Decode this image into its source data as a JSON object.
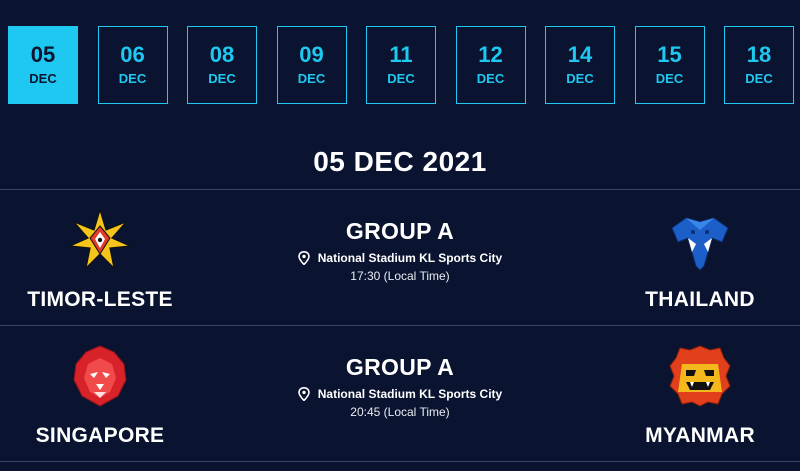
{
  "dates": [
    {
      "day": "05",
      "month": "DEC",
      "active": true
    },
    {
      "day": "06",
      "month": "DEC",
      "active": false
    },
    {
      "day": "08",
      "month": "DEC",
      "active": false
    },
    {
      "day": "09",
      "month": "DEC",
      "active": false
    },
    {
      "day": "11",
      "month": "DEC",
      "active": false
    },
    {
      "day": "12",
      "month": "DEC",
      "active": false
    },
    {
      "day": "14",
      "month": "DEC",
      "active": false
    },
    {
      "day": "15",
      "month": "DEC",
      "active": false
    },
    {
      "day": "18",
      "month": "DEC",
      "active": false
    }
  ],
  "day_title": "05 DEC 2021",
  "matches": [
    {
      "home": {
        "name": "TIMOR-LESTE",
        "crest": "timor-leste-star-crest-icon"
      },
      "away": {
        "name": "THAILAND",
        "crest": "thailand-elephant-crest-icon"
      },
      "group": "GROUP A",
      "venue": "National Stadium KL Sports City",
      "time": "17:30 (Local Time)"
    },
    {
      "home": {
        "name": "SINGAPORE",
        "crest": "singapore-lion-crest-icon"
      },
      "away": {
        "name": "MYANMAR",
        "crest": "myanmar-chinthe-crest-icon"
      },
      "group": "GROUP A",
      "venue": "National Stadium KL Sports City",
      "time": "20:45 (Local Time)"
    }
  ],
  "colors": {
    "background": "#0a1430",
    "accent": "#1ec8f0",
    "divider": "#3a4560"
  },
  "icons": {
    "venue": "location-pin-icon"
  }
}
